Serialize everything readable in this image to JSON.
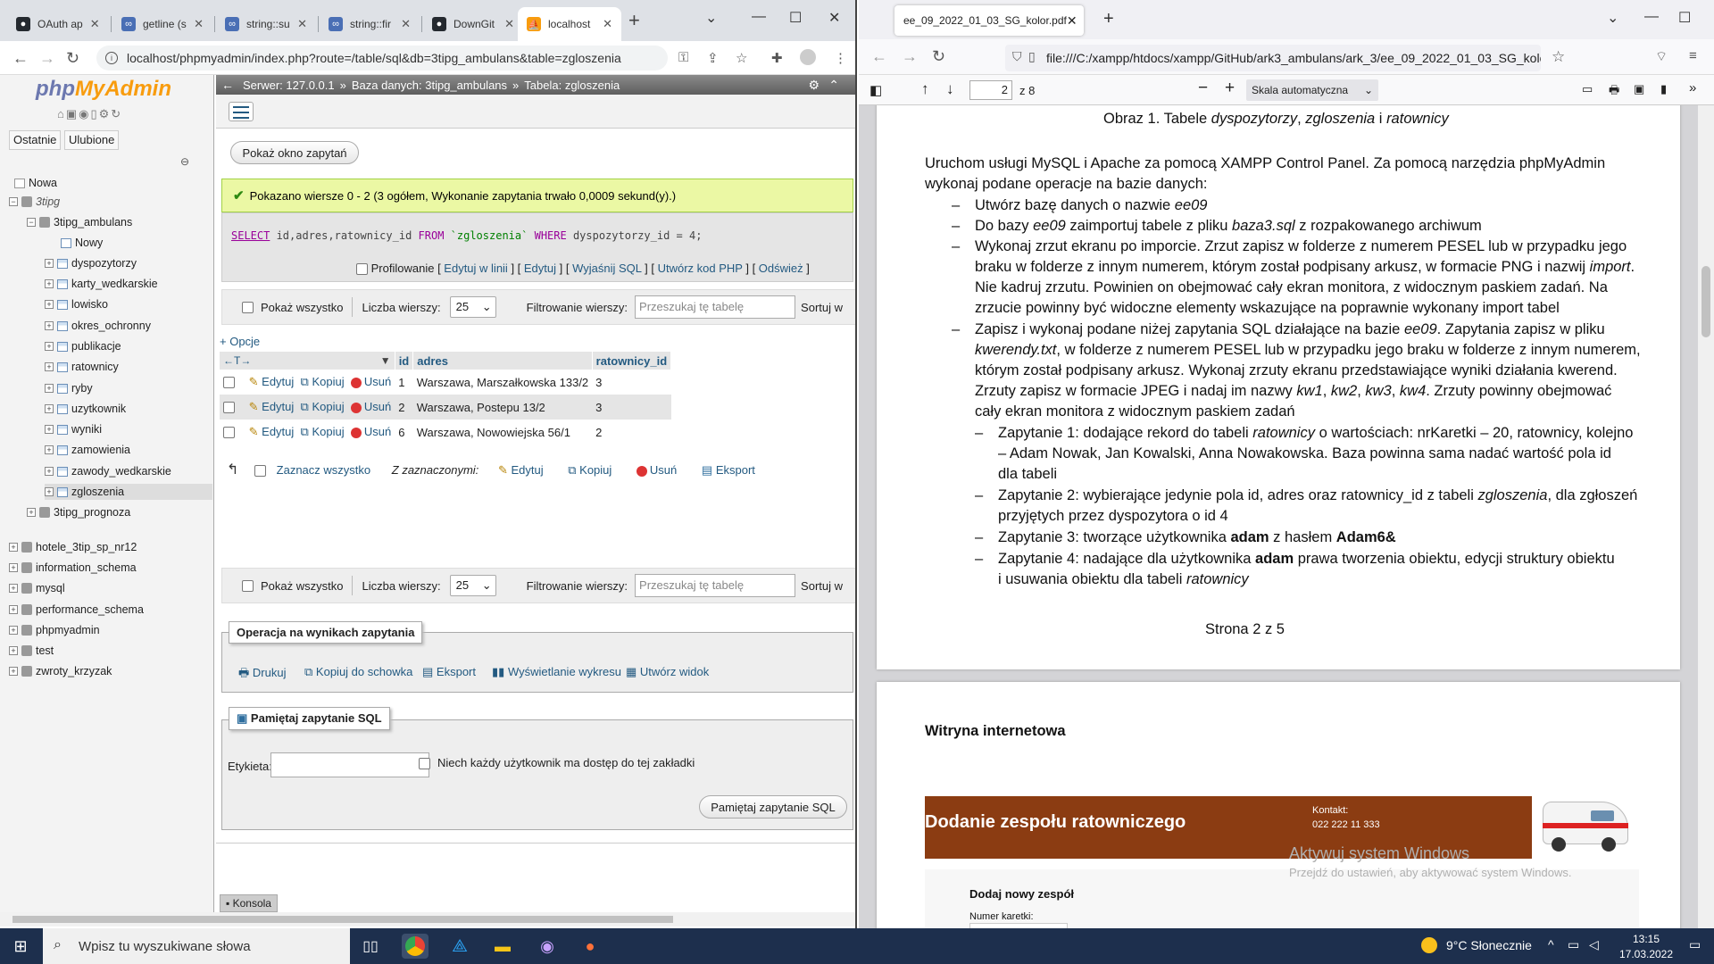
{
  "chrome": {
    "tabs": [
      {
        "label": "OAuth ap",
        "icon": "github-icon",
        "color": "#24292f"
      },
      {
        "label": "getline (s",
        "icon": "cplusplus-icon",
        "color": "#4a6fb5"
      },
      {
        "label": "string::su",
        "icon": "cplusplus-icon",
        "color": "#4a6fb5"
      },
      {
        "label": "string::fir",
        "icon": "cplusplus-icon",
        "color": "#4a6fb5"
      },
      {
        "label": "DownGit",
        "icon": "github-icon",
        "color": "#24292f"
      },
      {
        "label": "localhost",
        "icon": "phpmyadmin-icon",
        "color": "#f89c0e"
      }
    ],
    "url": "localhost/phpmyadmin/index.php?route=/table/sql&db=3tipg_ambulans&table=zgloszenia"
  },
  "pma": {
    "logo_a": "php",
    "logo_b": "MyAdmin",
    "recent": "Ostatnie",
    "favorites": "Ulubione",
    "tree": {
      "new": "Nowa",
      "db_3tipg": "3tipg",
      "db_ambulans": "3tipg_ambulans",
      "new_table": "Nowy",
      "tables": [
        "dyspozytorzy",
        "karty_wedkarskie",
        "lowisko",
        "okres_ochronny",
        "publikacje",
        "ratownicy",
        "ryby",
        "uzytkownik",
        "wyniki",
        "zamowienia",
        "zawody_wedkarskie",
        "zgloszenia"
      ],
      "db_prognoza": "3tipg_prognoza",
      "other_dbs": [
        "hotele_3tip_sp_nr12",
        "information_schema",
        "mysql",
        "performance_schema",
        "phpmyadmin",
        "test",
        "zwroty_krzyzak"
      ]
    },
    "breadcrumb": {
      "server": "Serwer: 127.0.0.1",
      "sep1": "»",
      "database": "Baza danych: 3tipg_ambulans",
      "sep2": "»",
      "table": "Tabela: zgloszenia"
    },
    "show_query_btn": "Pokaż okno zapytań",
    "success_msg": "Pokazano wiersze 0 - 2 (3 ogółem, Wykonanie zapytania trwało 0,0009 sekund(y).)",
    "sql": {
      "kw_select": "SELECT",
      "cols": " id,adres,ratownicy_id ",
      "kw_from": "FROM",
      "table": " `zgloszenia` ",
      "kw_where": "WHERE",
      "cond": " dyspozytorzy_id = 4;"
    },
    "sql_links": {
      "profiling": "Profilowanie",
      "inline": "Edytuj w linii",
      "edit": "Edytuj",
      "explain": "Wyjaśnij SQL",
      "php": "Utwórz kod PHP",
      "refresh": "Odśwież"
    },
    "nav": {
      "show_all": "Pokaż wszystko",
      "rows_label": "Liczba wierszy:",
      "rows_value": "25",
      "filter_label": "Filtrowanie wierszy:",
      "filter_placeholder": "Przeszukaj tę tabelę",
      "sort_label": "Sortuj w"
    },
    "options": "+ Opcje",
    "columns": [
      "id",
      "adres",
      "ratownicy_id"
    ],
    "row_actions": {
      "edit": "Edytuj",
      "copy": "Kopiuj",
      "delete": "Usuń"
    },
    "rows": [
      {
        "id": "1",
        "adres": "Warszawa, Marszałkowska 133/2",
        "ratownicy_id": "3"
      },
      {
        "id": "2",
        "adres": "Warszawa, Postepu 13/2",
        "ratownicy_id": "3"
      },
      {
        "id": "6",
        "adres": "Warszawa, Nowowiejska 56/1",
        "ratownicy_id": "2"
      }
    ],
    "bulk": {
      "check_all": "Zaznacz wszystko",
      "with_selected": "Z zaznaczonymi:",
      "edit": "Edytuj",
      "copy": "Kopiuj",
      "delete": "Usuń",
      "export": "Eksport"
    },
    "ops": {
      "title": "Operacja na wynikach zapytania",
      "print": "Drukuj",
      "clipboard": "Kopiuj do schowka",
      "export": "Eksport",
      "chart": "Wyświetlanie wykresu",
      "view": "Utwórz widok"
    },
    "bookmark": {
      "title": "Pamiętaj zapytanie SQL",
      "label": "Etykieta:",
      "shared": "Niech każdy użytkownik ma dostęp do tej zakładki",
      "button": "Pamiętaj zapytanie SQL"
    },
    "console": "Konsola"
  },
  "firefox": {
    "tab_title": "ee_09_2022_01_03_SG_kolor.pdf",
    "url": "file:///C:/xampp/htdocs/xampp/GitHub/ark3_ambulans/ark_3/ee_09_2022_01_03_SG_kolor.pdf",
    "page_num": "2",
    "page_total": "z 8",
    "zoom": "Skala automatyczna"
  },
  "pdf": {
    "caption_a": "Obraz 1. Tabele ",
    "caption_b": "dyspozytorzy",
    "caption_c": ", ",
    "caption_d": "zgloszenia",
    "caption_e": " i ",
    "caption_f": "ratownicy",
    "intro1": "Uruchom usługi MySQL i Apache za pomocą XAMPP Control Panel. Za pomocą narzędzia phpMyAdmin",
    "intro2": "wykonaj podane operacje na bazie danych:",
    "b1a": "Utwórz bazę danych o nazwie ",
    "b1b": "ee09",
    "b2a": "Do bazy ",
    "b2b": "ee09",
    "b2c": " zaimportuj tabele z pliku ",
    "b2d": "baza3.sql",
    "b2e": " z rozpakowanego archiwum",
    "b3l1a": "Wykonaj zrzut ekranu po imporcie. Zrzut zapisz w folderze z numerem PESEL lub w przypadku jego",
    "b3l2a": "braku w folderze z innym numerem, którym został podpisany arkusz, w formacie PNG i nazwij ",
    "b3l2b": "import",
    "b3l2c": ".",
    "b3l3": "Nie kadruj zrzutu. Powinien on obejmować cały ekran monitora, z widocznym paskiem zadań. Na",
    "b3l4": "zrzucie powinny być widoczne elementy wskazujące na poprawnie wykonany import tabel",
    "b4l1a": "Zapisz i wykonaj podane niżej zapytania SQL działające na bazie ",
    "b4l1b": "ee09",
    "b4l1c": ". Zapytania zapisz w pliku",
    "b4l2a": "kwerendy.txt",
    "b4l2b": ", w folderze z numerem PESEL lub w przypadku jego braku w folderze z innym numerem,",
    "b4l3": "którym został podpisany arkusz. Wykonaj zrzuty ekranu przedstawiające wyniki działania kwerend.",
    "b4l4a": "Zrzuty zapisz w formacie JPEG i nadaj im nazwy ",
    "b4l4b": "kw1",
    "b4l4c": ", ",
    "b4l4d": "kw2",
    "b4l4e": ", ",
    "b4l4f": "kw3",
    "b4l4g": ", ",
    "b4l4h": "kw4",
    "b4l4i": ". Zrzuty powinny obejmować",
    "b4l5": "cały ekran monitora z widocznym paskiem zadań",
    "q1l1a": "Zapytanie 1: dodające rekord do tabeli ",
    "q1l1b": "ratownicy",
    "q1l1c": " o wartościach: nrKaretki – 20, ratownicy, kolejno",
    "q1l2": "– Adam Nowak, Jan Kowalski, Anna Nowakowska. Baza powinna sama nadać wartość pola id",
    "q1l3": "dla tabeli",
    "q2l1a": "Zapytanie 2: wybierające jedynie pola id, adres oraz ratownicy_id z tabeli ",
    "q2l1b": "zgloszenia",
    "q2l1c": ", dla zgłoszeń",
    "q2l2": "przyjętych przez dyspozytora o id 4",
    "q3a": "Zapytanie 3: tworzące użytkownika ",
    "q3b": "adam",
    "q3c": " z hasłem ",
    "q3d": "Adam6&",
    "q4l1a": "Zapytanie 4: nadające dla użytkownika ",
    "q4l1b": "adam",
    "q4l1c": " prawa tworzenia obiektu, edycji struktury obiektu",
    "q4l2a": "i usuwania obiektu dla tabeli ",
    "q4l2b": "ratownicy",
    "page_footer": "Strona 2 z 5",
    "site_section": "Witryna internetowa",
    "site_title": "Dodanie zespołu ratowniczego",
    "contact_label": "Kontakt:",
    "contact_phone": "022 222 11 333",
    "form_heading": "Dodaj nowy zespół",
    "form_field": "Numer karetki:",
    "watermark1": "Aktywuj system Windows",
    "watermark2": "Przejdź do ustawień, aby aktywować system Windows.",
    "dash": "–"
  },
  "taskbar": {
    "search_placeholder": "Wpisz tu wyszukiwane słowa",
    "weather": "9°C  Słonecznie",
    "time": "13:15",
    "date": "17.03.2022"
  }
}
